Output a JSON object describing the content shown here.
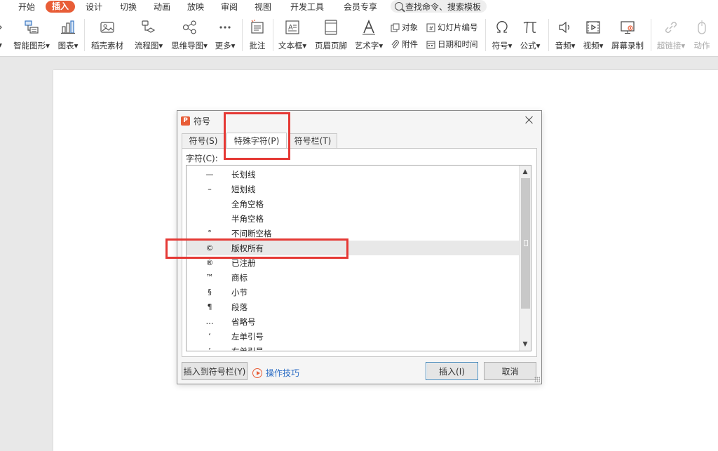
{
  "menubar": {
    "items": [
      "开始",
      "插入",
      "设计",
      "切换",
      "动画",
      "放映",
      "审阅",
      "视图",
      "开发工具",
      "会员专享"
    ],
    "active": "插入",
    "search_placeholder": "查找命令、搜索模板"
  },
  "ribbon": {
    "buttons": [
      {
        "label": "智能图形",
        "dropdown": true
      },
      {
        "label": "图表",
        "dropdown": true
      },
      {
        "label": "稻壳素材",
        "dropdown": false
      },
      {
        "label": "流程图",
        "dropdown": true
      },
      {
        "label": "思维导图",
        "dropdown": true
      },
      {
        "label": "更多",
        "dropdown": true
      },
      {
        "label": "批注",
        "dropdown": false
      },
      {
        "label": "文本框",
        "dropdown": true
      },
      {
        "label": "页眉页脚",
        "dropdown": false
      },
      {
        "label": "艺术字",
        "dropdown": true
      },
      {
        "label": "符号",
        "dropdown": true
      },
      {
        "label": "公式",
        "dropdown": true
      },
      {
        "label": "音频",
        "dropdown": true
      },
      {
        "label": "视频",
        "dropdown": true
      },
      {
        "label": "屏幕录制",
        "dropdown": false
      },
      {
        "label": "超链接",
        "dropdown": true
      },
      {
        "label": "动作",
        "dropdown": false
      }
    ],
    "small": {
      "object": "对象",
      "slide_number": "幻灯片编号",
      "attachment": "附件",
      "datetime": "日期和时间"
    }
  },
  "dialog": {
    "title": "符号",
    "logo": "P",
    "tabs": [
      "符号(S)",
      "特殊字符(P)",
      "符号栏(T)"
    ],
    "active_tab": "特殊字符(P)",
    "char_label": "字符(C):",
    "rows": [
      {
        "symbol": "—",
        "name": "长划线"
      },
      {
        "symbol": "–",
        "name": "短划线"
      },
      {
        "symbol": "",
        "name": "全角空格"
      },
      {
        "symbol": "",
        "name": "半角空格"
      },
      {
        "symbol": "°",
        "name": "不间断空格"
      },
      {
        "symbol": "©",
        "name": "版权所有"
      },
      {
        "symbol": "®",
        "name": "已注册"
      },
      {
        "symbol": "™",
        "name": "商标"
      },
      {
        "symbol": "§",
        "name": "小节"
      },
      {
        "symbol": "¶",
        "name": "段落"
      },
      {
        "symbol": "…",
        "name": "省略号"
      },
      {
        "symbol": "‘",
        "name": "左单引号"
      },
      {
        "symbol": "’",
        "name": "右单引号"
      }
    ],
    "selected_row": "版权所有",
    "insert_to_bar_label": "插入到符号栏(Y)",
    "tips_label": "操作技巧",
    "insert_label": "插入(I)",
    "cancel_label": "取消"
  },
  "colors": {
    "accent": "#e85d37",
    "annotation": "#e53935",
    "link": "#2b6cc4"
  }
}
